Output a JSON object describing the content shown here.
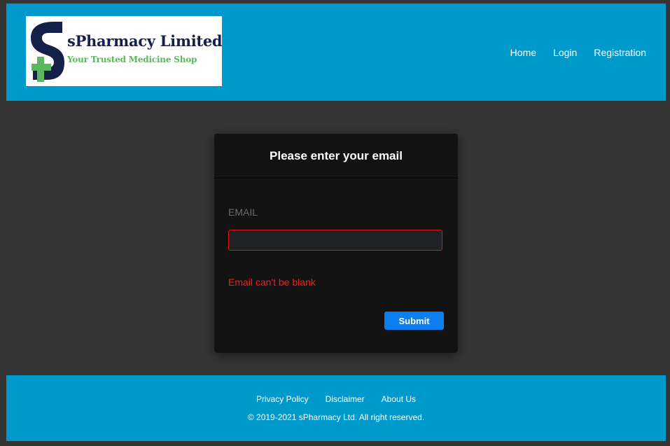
{
  "colors": {
    "background": "#343434",
    "header_bg": "#0099cc",
    "card_bg": "#121212",
    "input_border_error": "#e0131b",
    "error_text": "#ff1a1a",
    "submit_bg": "#0d7ef0",
    "logo_navy": "#15204a",
    "logo_green": "#5cb85c"
  },
  "header": {
    "logo": {
      "title": "sPharmacy Limited",
      "tagline": "Your Trusted Medicine Shop",
      "icons": [
        "s-letter-icon",
        "green-cross-icon"
      ]
    },
    "nav": {
      "home": "Home",
      "login": "Login",
      "registration": "Registration"
    }
  },
  "form": {
    "title": "Please enter your email",
    "email_label": "EMAIL",
    "email_value": "",
    "error_message": "Email can't be blank",
    "submit_label": "Submit"
  },
  "footer": {
    "links": {
      "privacy": "Privacy Policy",
      "disclaimer": "Disclaimer",
      "about": "About Us"
    },
    "copyright": "© 2019-2021 sPharmacy Ltd. All right reserved."
  }
}
